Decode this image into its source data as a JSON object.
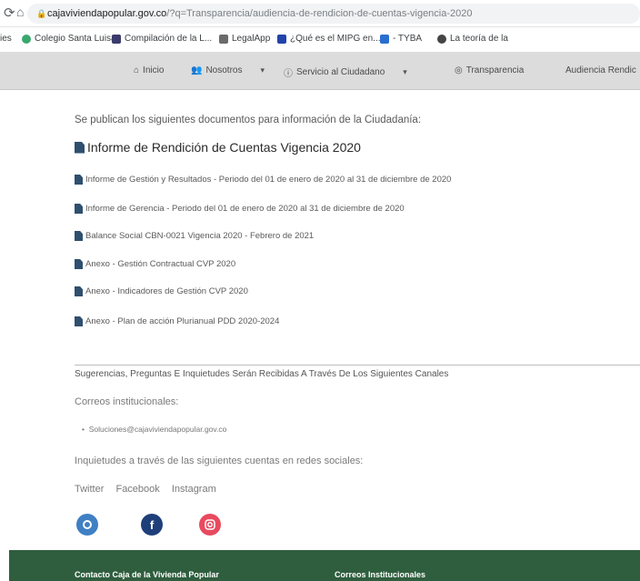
{
  "browser": {
    "url_host": "cajaviviendapopular.gov.co",
    "url_path": "/?q=Transparencia/audiencia-de-rendicion-de-cuentas-vigencia-2020",
    "bookmarks": [
      "ies",
      "Colegio Santa Luisa",
      "Compilación de la L...",
      "LegalApp",
      "¿Qué es el MIPG en...",
      "- TYBA",
      "La teoría de la"
    ]
  },
  "site_nav": {
    "items": [
      "Inicio",
      "Nosotros",
      "Servicio al Ciudadano",
      "Transparencia",
      "Audiencia Rendic"
    ]
  },
  "main": {
    "intro": "Se publican los siguientes documentos para información de la Ciudadanía:",
    "title": "Informe de Rendición de Cuentas Vigencia 2020",
    "documents": [
      "Informe de Gestión y Resultados - Periodo del 01 de enero de 2020 al 31 de diciembre de 2020",
      "Informe de Gerencia - Periodo del 01 de enero de 2020 al 31 de diciembre de 2020",
      "Balance Social CBN-0021 Vigencia 2020 - Febrero de 2021",
      "Anexo - Gestión Contractual CVP 2020",
      "Anexo - Indicadores de Gestión CVP 2020",
      "Anexo - Plan de acción Plurianual PDD 2020-2024"
    ],
    "suggestions": "Sugerencias, Preguntas E Inquietudes Serán Recibidas A Través De Los Siguientes Canales",
    "correos_label": "Correos institucionales:",
    "email": "Soluciones@cajaviviendapopular.gov.co",
    "inquietudes": "Inquietudes a través de las siguientes cuentas en redes sociales:",
    "social": [
      "Twitter",
      "Facebook",
      "Instagram"
    ],
    "colors": {
      "twitter": "#3f7fc4",
      "facebook": "#1f3f7a",
      "instagram": "#e84a5f"
    }
  },
  "footer": {
    "left": "Contacto Caja de la Vivienda Popular",
    "right": "Correos Institucionales"
  }
}
